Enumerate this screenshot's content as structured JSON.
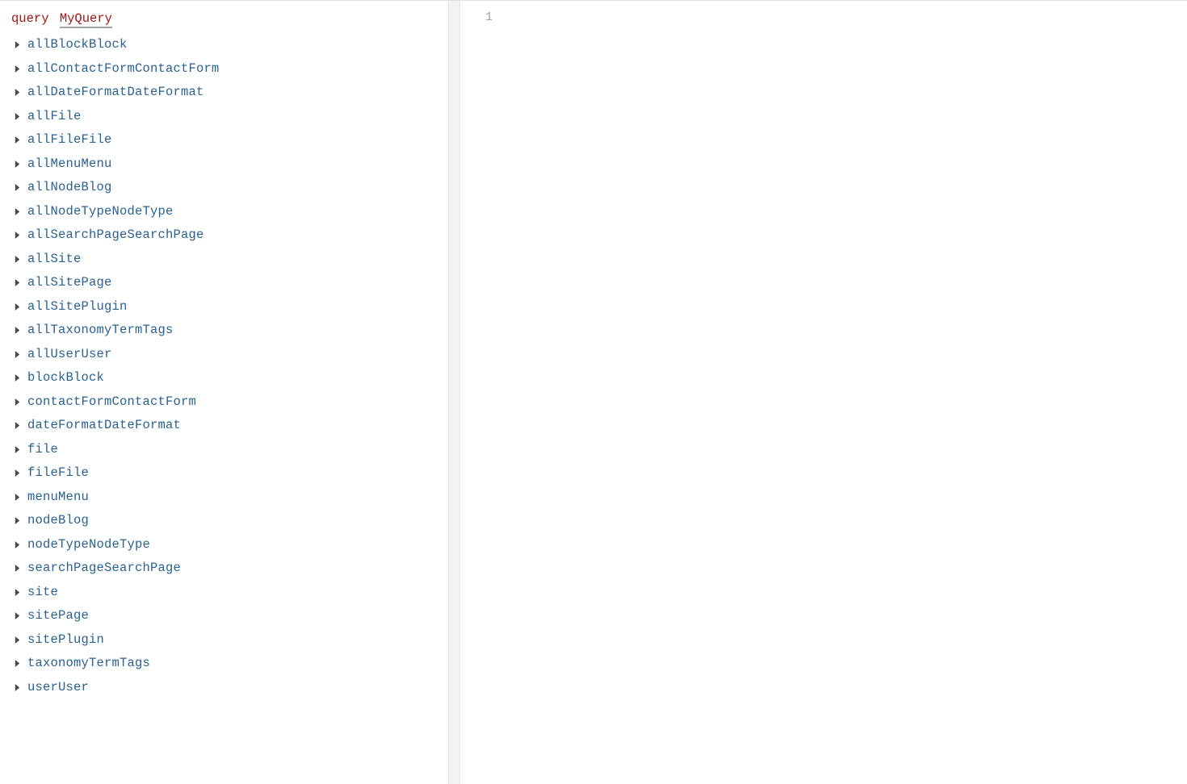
{
  "editor": {
    "lineNumbers": [
      "1"
    ],
    "content": ""
  },
  "explorer": {
    "keyword": "query",
    "queryName": "MyQuery",
    "fields": [
      "allBlockBlock",
      "allContactFormContactForm",
      "allDateFormatDateFormat",
      "allFile",
      "allFileFile",
      "allMenuMenu",
      "allNodeBlog",
      "allNodeTypeNodeType",
      "allSearchPageSearchPage",
      "allSite",
      "allSitePage",
      "allSitePlugin",
      "allTaxonomyTermTags",
      "allUserUser",
      "blockBlock",
      "contactFormContactForm",
      "dateFormatDateFormat",
      "file",
      "fileFile",
      "menuMenu",
      "nodeBlog",
      "nodeTypeNodeType",
      "searchPageSearchPage",
      "site",
      "sitePage",
      "sitePlugin",
      "taxonomyTermTags",
      "userUser"
    ]
  }
}
